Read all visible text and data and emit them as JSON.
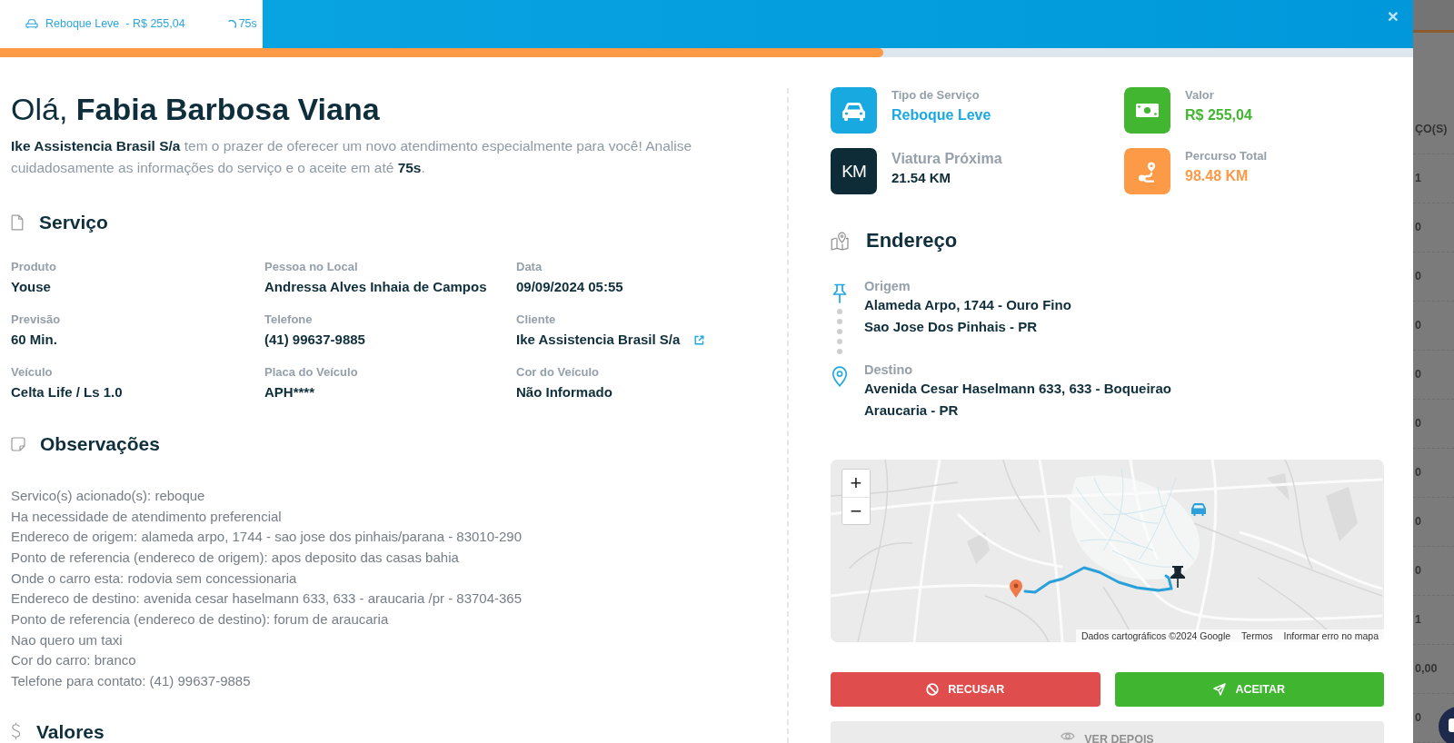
{
  "tab": {
    "service": "Reboque Leve",
    "price": "- R$ 255,04",
    "countdown": "75s",
    "close": "×"
  },
  "progress": {
    "level": 0.625
  },
  "greeting": "Olá, **Fabia Barbosa Viana**",
  "intro": "**Ike Assistencia Brasil S/a** tem o prazer de oferecer um novo atendimento especialmente para você! Analise cuidadosamente as informações do serviço e o aceite em até **75s**.",
  "service": {
    "title": "Serviço",
    "fields": [
      {
        "label": "Produto",
        "value": "Youse",
        "external_link": false
      },
      {
        "label": "Pessoa no Local",
        "value": "Andressa Alves Inhaia de Campos",
        "external_link": false
      },
      {
        "label": "Data",
        "value": "09/09/2024 05:55",
        "external_link": false
      },
      {
        "label": "Previsão",
        "value": "60 Min.",
        "external_link": false
      },
      {
        "label": "Telefone",
        "value": "(41) 99637-9885",
        "external_link": false
      },
      {
        "label": "Cliente",
        "value": "Ike Assistencia Brasil S/a",
        "external_link": true
      },
      {
        "label": "Veículo",
        "value": "Celta Life / Ls 1.0",
        "external_link": false
      },
      {
        "label": "Placa do Veículo",
        "value": "APH****",
        "external_link": false
      },
      {
        "label": "Cor do Veículo",
        "value": "Não Informado",
        "external_link": false
      }
    ]
  },
  "observations": {
    "title": "Observações",
    "lines": [
      "Servico(s) acionado(s): reboque",
      "Ha necessidade de atendimento preferencial",
      "Endereco de origem: alameda arpo, 1744 - sao jose dos pinhais/parana - 83010-290",
      "Ponto de referencia (endereco de origem): apos deposito das casas bahia",
      "Onde o carro esta: rodovia sem concessionaria",
      "Endereco de destino: avenida cesar haselmann 633, 633 - araucaria /pr - 83704-365",
      "Ponto de referencia (endereco de destino): forum de araucaria",
      "Nao quero um taxi",
      "Cor do carro: branco",
      "Telefone para contato: (41) 99637-9885"
    ]
  },
  "values": {
    "title": "Valores"
  },
  "summary": [
    {
      "kind": "car",
      "label": "Tipo de Serviço",
      "value": "Reboque Leve",
      "color": "#18a9e1"
    },
    {
      "kind": "money",
      "label": "Valor",
      "value": "R$ 255,04",
      "color": "#42b631"
    },
    {
      "kind": "km",
      "badge": "KM",
      "label": "Viatura Próxima",
      "value": "21.54 KM",
      "color": "#0e2b38"
    },
    {
      "kind": "route",
      "label": "Percurso Total",
      "value": "98.48 KM",
      "color": "#fd9a47"
    }
  ],
  "address": {
    "title": "Endereço",
    "stops": [
      {
        "kind": "origin",
        "label": "Origem",
        "lines": [
          "Alameda Arpo, 1744 - Ouro Fino",
          "Sao Jose Dos Pinhais - PR"
        ]
      },
      {
        "kind": "destination",
        "label": "Destino",
        "lines": [
          "Avenida Cesar Haselmann 633, 633 - Boqueirao",
          "Araucaria - PR"
        ]
      }
    ]
  },
  "map": {
    "zoom_in": "+",
    "zoom_out": "−",
    "attribution": "Dados cartográficos ©2024 Google",
    "links": [
      "Termos",
      "Informar erro no mapa"
    ]
  },
  "actions": [
    {
      "kind": "decline",
      "label": "RECUSAR"
    },
    {
      "kind": "accept",
      "label": "ACEITAR"
    },
    {
      "kind": "later",
      "label": "VER DEPOIS"
    }
  ],
  "backdrop": {
    "fragments": [
      "ÇO(S)",
      "1",
      "0",
      "0",
      "0",
      "0",
      "0",
      "0",
      "0",
      "0",
      "1",
      "0,00",
      "0"
    ]
  }
}
